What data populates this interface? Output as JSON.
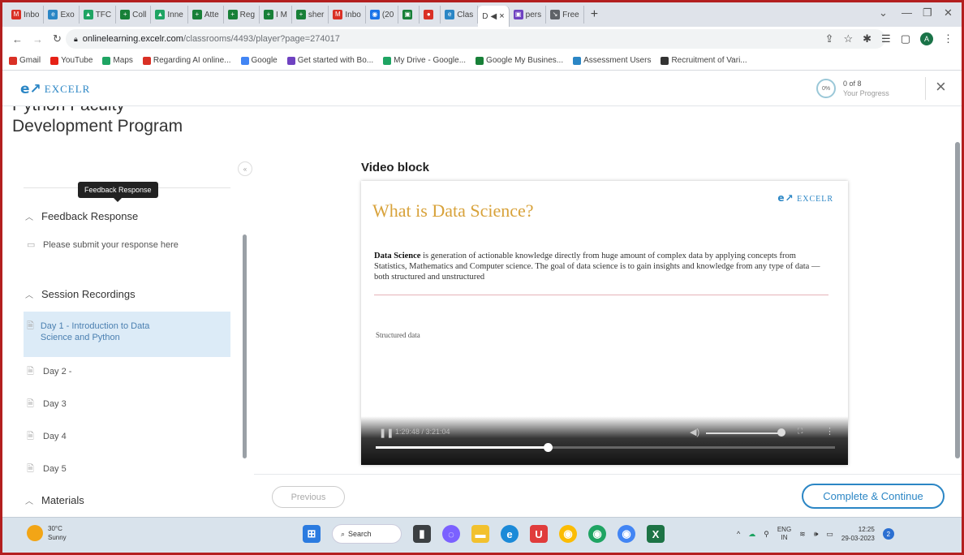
{
  "browser": {
    "tabs": [
      {
        "label": "Inbo",
        "color": "#d93025",
        "glyph": "M"
      },
      {
        "label": "Exo",
        "color": "#2b86c5",
        "glyph": "e"
      },
      {
        "label": "TFC",
        "color": "#1fa463",
        "glyph": "▲"
      },
      {
        "label": "Coll",
        "color": "#188038",
        "glyph": "+"
      },
      {
        "label": "Inne",
        "color": "#1fa463",
        "glyph": "▲"
      },
      {
        "label": "Atte",
        "color": "#188038",
        "glyph": "+"
      },
      {
        "label": "Reg",
        "color": "#188038",
        "glyph": "+"
      },
      {
        "label": "I M",
        "color": "#188038",
        "glyph": "+"
      },
      {
        "label": "sher",
        "color": "#188038",
        "glyph": "+"
      },
      {
        "label": "Inbo",
        "color": "#d93025",
        "glyph": "M"
      },
      {
        "label": "(20",
        "color": "#1a73e8",
        "glyph": "◉"
      },
      {
        "label": "",
        "color": "#188038",
        "glyph": "▣"
      },
      {
        "label": "",
        "color": "#d93025",
        "glyph": "●"
      },
      {
        "label": "Clas",
        "color": "#2b86c5",
        "glyph": "e"
      }
    ],
    "active_tab": {
      "label": "D",
      "icon": "speaker-icon"
    },
    "tabs_after": [
      {
        "label": "pers",
        "color": "#6f42c1",
        "glyph": "▣"
      },
      {
        "label": "Free",
        "color": "#5f6368",
        "glyph": "↘"
      }
    ],
    "url_host": "onlinelearning.excelr.com",
    "url_path": "/classrooms/4493/player?page=274017",
    "profile_initial": "A",
    "bookmarks": [
      {
        "label": "Gmail",
        "color": "#d93025"
      },
      {
        "label": "YouTube",
        "color": "#e62117"
      },
      {
        "label": "Maps",
        "color": "#1fa463"
      },
      {
        "label": "Regarding AI online...",
        "color": "#d93025"
      },
      {
        "label": "Google",
        "color": "#4285f4"
      },
      {
        "label": "Get started with Bo...",
        "color": "#6f42c1"
      },
      {
        "label": "My Drive - Google...",
        "color": "#1fa463"
      },
      {
        "label": "Google My Busines...",
        "color": "#188038"
      },
      {
        "label": "Assessment Users",
        "color": "#2b86c5"
      },
      {
        "label": "Recruitment of Vari...",
        "color": "#333333"
      }
    ]
  },
  "header": {
    "logo_text": "EXCELR",
    "progress_percent": "0%",
    "progress_count": "0 of 8",
    "progress_label": "Your Progress"
  },
  "sidebar": {
    "course_title_part1": "Python Faculty",
    "course_title_part2": "Development Program",
    "tooltip": "Feedback Response",
    "sections": [
      {
        "label": "Feedback Response"
      },
      {
        "label": "Session Recordings"
      },
      {
        "label": "Materials"
      }
    ],
    "feedback_item": "Please submit your response here",
    "recordings": [
      {
        "label": "Day 1 - Introduction to Data Science and Python"
      },
      {
        "label": "Day 2 -"
      },
      {
        "label": "Day 3"
      },
      {
        "label": "Day 4"
      },
      {
        "label": "Day 5"
      }
    ]
  },
  "content": {
    "block_label": "Video block",
    "slide_title": "What is Data Science?",
    "slide_logo": "EXCELR",
    "slide_bold": "Data Science",
    "slide_body": " is generation of actionable knowledge directly from huge amount of complex data by applying concepts from Statistics, Mathematics and Computer science. The goal of data science is to gain insights and knowledge from any type of data — both structured and unstructured",
    "slide_sub": "Structured data",
    "video_time": "1:29:48 / 3:21:04",
    "seek_progress": 0.375
  },
  "footer": {
    "previous": "Previous",
    "complete": "Complete & Continue"
  },
  "taskbar": {
    "temp": "30°C",
    "weather": "Sunny",
    "search": "Search",
    "lang_top": "ENG",
    "lang_bottom": "IN",
    "time": "12:25",
    "date": "29-03-2023",
    "notifications": "2"
  }
}
